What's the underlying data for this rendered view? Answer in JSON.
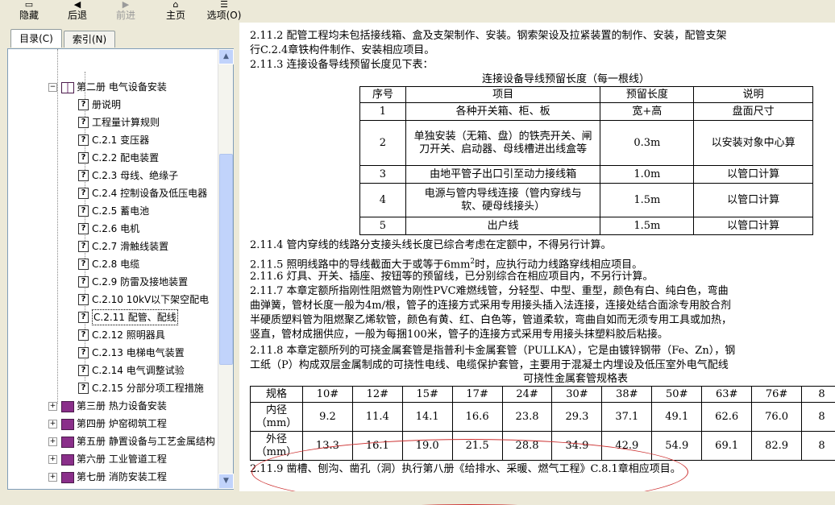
{
  "toolbar": {
    "items": [
      {
        "label": "隐藏",
        "icon": "hide-icon"
      },
      {
        "label": "后退",
        "icon": "back-icon"
      },
      {
        "label": "前进",
        "icon": "forward-icon"
      },
      {
        "label": "主页",
        "icon": "home-icon"
      },
      {
        "label": "选项(O)",
        "icon": "options-icon"
      }
    ]
  },
  "sidebar": {
    "tabs": [
      "目录(C)",
      "索引(N)"
    ],
    "tree": [
      {
        "label": "第二册 电气设备安装",
        "type": "book-open",
        "level": 1,
        "expander": "−"
      },
      {
        "label": "册说明",
        "type": "topic",
        "level": 2
      },
      {
        "label": "工程量计算规则",
        "type": "topic",
        "level": 2
      },
      {
        "label": "C.2.1  变压器",
        "type": "topic",
        "level": 2
      },
      {
        "label": "C.2.2  配电装置",
        "type": "topic",
        "level": 2
      },
      {
        "label": "C.2.3  母线、绝缘子",
        "type": "topic",
        "level": 2
      },
      {
        "label": "C.2.4  控制设备及低压电器",
        "type": "topic",
        "level": 2
      },
      {
        "label": "C.2.5  蓄电池",
        "type": "topic",
        "level": 2
      },
      {
        "label": "C.2.6  电机",
        "type": "topic",
        "level": 2
      },
      {
        "label": "C.2.7  滑触线装置",
        "type": "topic",
        "level": 2
      },
      {
        "label": "C.2.8  电缆",
        "type": "topic",
        "level": 2
      },
      {
        "label": "C.2.9  防雷及接地装置",
        "type": "topic",
        "level": 2
      },
      {
        "label": "C.2.10  10kV以下架空配电",
        "type": "topic",
        "level": 2
      },
      {
        "label": "C.2.11 配管、配线",
        "type": "topic",
        "level": 2,
        "selected": true
      },
      {
        "label": "C.2.12  照明器具",
        "type": "topic",
        "level": 2
      },
      {
        "label": "C.2.13  电梯电气装置",
        "type": "topic",
        "level": 2
      },
      {
        "label": "C.2.14  电气调整试验",
        "type": "topic",
        "level": 2
      },
      {
        "label": "C.2.15  分部分项工程措施",
        "type": "topic",
        "level": 2
      },
      {
        "label": "第三册 热力设备安装",
        "type": "book",
        "level": 1,
        "expander": "+"
      },
      {
        "label": "第四册 炉窑砌筑工程",
        "type": "book",
        "level": 1,
        "expander": "+"
      },
      {
        "label": "第五册 静置设备与工艺金属结构",
        "type": "book",
        "level": 1,
        "expander": "+"
      },
      {
        "label": "第六册 工业管道工程",
        "type": "book",
        "level": 1,
        "expander": "+"
      },
      {
        "label": "第七册 消防安装工程",
        "type": "book",
        "level": 1,
        "expander": "+"
      }
    ]
  },
  "content": {
    "p_2_11_2_a": "2.11.2  配管工程均未包括接线箱、盒及支架制作、安装。钢索架设及拉紧装置的制作、安装，配管支架",
    "p_2_11_2_b": "行C.2.4章铁构件制作、安装相应项目。",
    "p_2_11_3": "2.11.3  连接设备导线预留长度见下表：",
    "table1_title": "连接设备导线预留长度（每一根线）",
    "table1": {
      "headers": [
        "序号",
        "项目",
        "预留长度",
        "说明"
      ],
      "rows": [
        [
          "1",
          "各种开关箱、柜、板",
          "宽+高",
          "盘面尺寸"
        ],
        [
          "2",
          "单独安装（无箱、盘）的铁壳开关、闸刀开关、启动器、母线槽进出线盒等",
          "0.3m",
          "以安装对象中心算"
        ],
        [
          "3",
          "由地平管子出口引至动力接线箱",
          "1.0m",
          "以管口计算"
        ],
        [
          "4",
          "电源与管内导线连接（管内穿线与软、硬母线接头）",
          "1.5m",
          "以管口计算"
        ],
        [
          "5",
          "出户线",
          "1.5m",
          "以管口计算"
        ]
      ]
    },
    "p_2_11_4": "2.11.4  管内穿线的线路分支接头线长度已综合考虑在定额中，不得另行计算。",
    "p_2_11_5_pre": "2.11.5  照明线路中的导线截面大于或等于6mm",
    "p_2_11_5_sup": "2",
    "p_2_11_5_post": "时，应执行动力线路穿线相应项目。",
    "p_2_11_6": "2.11.6  灯具、开关、插座、按钮等的预留线，已分别综合在相应项目内，不另行计算。",
    "p_2_11_7_a": "2.11.7  本章定额所指刚性阻燃管为刚性PVC难燃线管，分轻型、中型、重型，颜色有白、纯白色，弯曲",
    "p_2_11_7_b": "曲弹簧，管材长度一般为4m/根，管子的连接方式采用专用接头插入法连接，连接处结合面涂专用胶合剂",
    "p_2_11_7_c": "半硬质塑料管为阻燃聚乙烯软管，颜色有黄、红、白色等，管道柔软，弯曲自如而无须专用工具或加热，",
    "p_2_11_7_d": "竖直，管材成捆供应，一般为每捆100米，管子的连接方式采用专用接头抹塑料胶后粘接。",
    "p_2_11_8_a": "2.11.8  本章定额所列的可挠金属套管是指普利卡金属套管（PULLKA），它是由镀锌钢带（Fe、Zn），钢",
    "p_2_11_8_b": "工纸（P）构成双层金属制成的可挠性电线、电缆保护套管，主要用于混凝土内埋设及低压室外电气配线",
    "table2_title": "可挠性金属套管规格表",
    "table2": {
      "header_label": "规格",
      "sizes": [
        "10#",
        "12#",
        "15#",
        "17#",
        "24#",
        "30#",
        "38#",
        "50#",
        "63#",
        "76#",
        "8"
      ],
      "inner_label_1": "内径",
      "inner_label_2": "（mm）",
      "inner": [
        "9.2",
        "11.4",
        "14.1",
        "16.6",
        "23.8",
        "29.3",
        "37.1",
        "49.1",
        "62.6",
        "76.0",
        "8"
      ],
      "outer_label_1": "外径",
      "outer_label_2": "（mm）",
      "outer": [
        "13.3",
        "16.1",
        "19.0",
        "21.5",
        "28.8",
        "34.9",
        "42.9",
        "54.9",
        "69.1",
        "82.9",
        "8"
      ]
    },
    "p_2_11_9": "2.11.9  凿槽、刨沟、凿孔（洞）执行第八册《给排水、采暖、燃气工程》C.8.1章相应项目。"
  }
}
